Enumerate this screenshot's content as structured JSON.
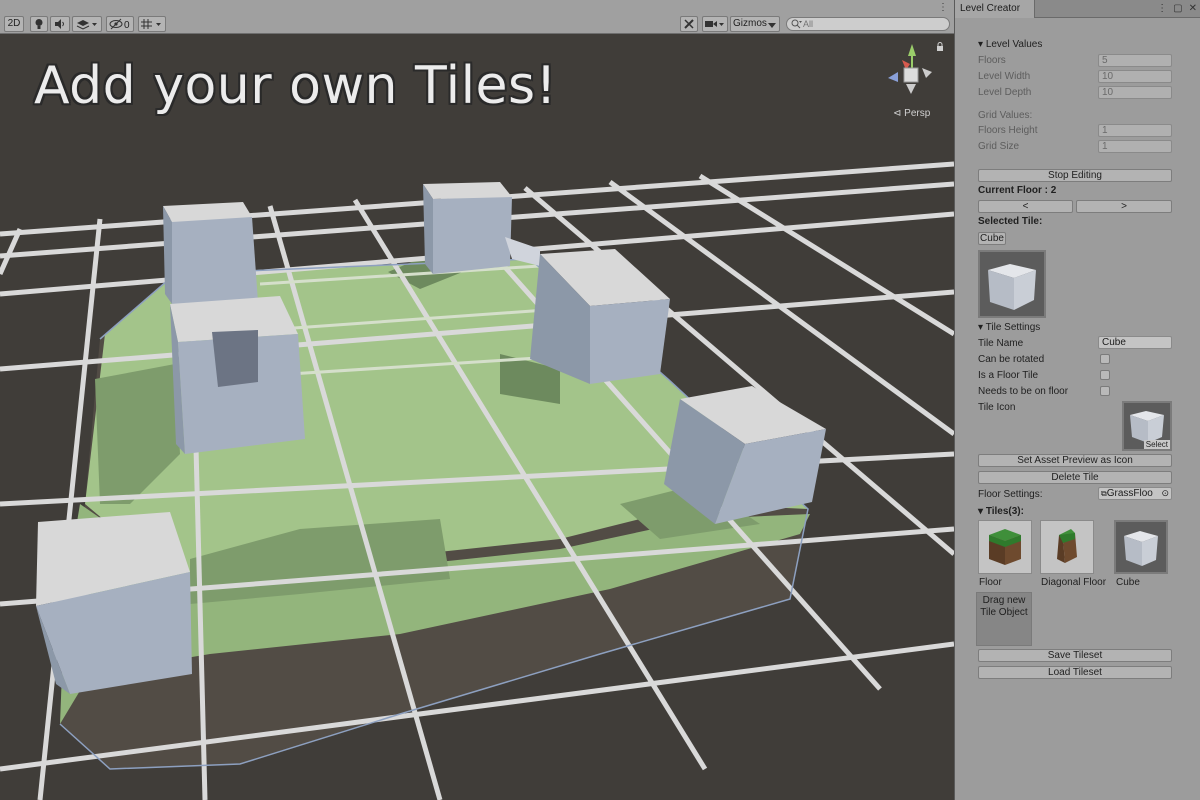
{
  "toolbar": {
    "mode_2d": "2D",
    "hidden_count": "0",
    "gizmos_label": "Gizmos",
    "search_placeholder": "All"
  },
  "scene": {
    "overlay_title": "Add your own Tiles!",
    "persp_label": "Persp",
    "colors": {
      "background": "#403d39",
      "grid": "#d9d9d9",
      "grass": "#a3c48a",
      "cube": "#a6b0c0"
    }
  },
  "panel": {
    "tab_title": "Level Creator",
    "level_values": {
      "header": "Level Values",
      "floors_label": "Floors",
      "floors_value": "5",
      "level_width_label": "Level Width",
      "level_width_value": "10",
      "level_depth_label": "Level Depth",
      "level_depth_value": "10"
    },
    "grid_values": {
      "header": "Grid Values:",
      "floors_height_label": "Floors Height",
      "floors_height_value": "1",
      "grid_size_label": "Grid Size",
      "grid_size_value": "1"
    },
    "stop_editing_label": "Stop Editing",
    "current_floor_label": "Current Floor : 2",
    "prev_floor_label": "<",
    "next_floor_label": ">",
    "selected_tile_label": "Selected Tile:",
    "selected_tile_name": "Cube",
    "tile_settings": {
      "header": "Tile Settings",
      "tile_name_label": "Tile Name",
      "tile_name_value": "Cube",
      "can_be_rotated_label": "Can be rotated",
      "can_be_rotated": false,
      "is_floor_tile_label": "Is a Floor Tile",
      "is_floor_tile": false,
      "needs_floor_label": "Needs to be on floor",
      "needs_floor": false,
      "tile_icon_label": "Tile Icon",
      "select_label": "Select"
    },
    "set_asset_preview_label": "Set Asset Preview as Icon",
    "delete_tile_label": "Delete Tile",
    "floor_settings_label": "Floor Settings:",
    "floor_settings_value": "GrassFloo",
    "tiles_header": "Tiles(3):",
    "tiles": [
      {
        "name": "Floor",
        "icon": "grass-floor-tile-icon"
      },
      {
        "name": "Diagonal Floor",
        "icon": "diagonal-floor-tile-icon"
      },
      {
        "name": "Cube",
        "icon": "cube-tile-icon"
      }
    ],
    "drag_new_label": "Drag new Tile Object",
    "save_tileset_label": "Save Tileset",
    "load_tileset_label": "Load Tileset"
  }
}
